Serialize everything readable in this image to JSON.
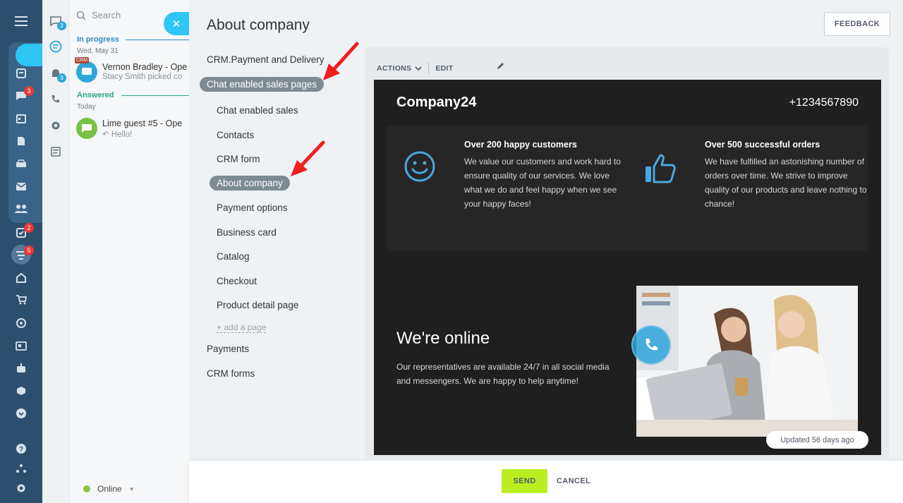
{
  "colors": {
    "accent": "#2fc6f6",
    "send": "#bbed21",
    "sidebar": "#2c4f6e",
    "arrow": "#f01e1e"
  },
  "iconbar": {
    "icons": [
      "menu-icon",
      "feed-icon",
      "chat-icon",
      "calendar-icon",
      "document-icon",
      "drive-icon",
      "mail-icon",
      "group-icon",
      "tasks-icon",
      "crm-icon",
      "sites-icon",
      "shop-icon",
      "marketing-icon",
      "contact-center-icon",
      "robot-icon",
      "apps-icon",
      "more-icon",
      "help-icon",
      "sitemap-icon",
      "settings-icon"
    ],
    "badges": {
      "chat": "3",
      "tasks": "2",
      "crm": "5"
    }
  },
  "chatbar": {
    "badges": {
      "messages": "3",
      "notifications": "3"
    }
  },
  "chatlist": {
    "search_placeholder": "Search",
    "section_progress": "In progress",
    "date1": "Wed, May 31",
    "chat1": {
      "tag": "CRM",
      "name": "Vernon Bradley - Ope",
      "sub": "Stacy Smith picked co"
    },
    "section_answered": "Answered",
    "date2": "Today",
    "chat2": {
      "name": "Lime guest #5 - Ope",
      "sub": "Hello!"
    },
    "status": "Online"
  },
  "slider": {
    "title": "About company",
    "feedback": "FEEDBACK",
    "tree": {
      "crm_payment": "CRM.Payment and Delivery",
      "chat_pages": "Chat enabled sales pages",
      "chat_sales": "Chat enabled sales",
      "contacts": "Contacts",
      "crm_form": "CRM form",
      "about": "About company",
      "payment_options": "Payment options",
      "business_card": "Business card",
      "catalog": "Catalog",
      "checkout": "Checkout",
      "product_detail": "Product detail page",
      "add_page": "+ add a page",
      "payments": "Payments",
      "crm_forms": "CRM forms"
    },
    "toolbar": {
      "actions": "ACTIONS",
      "edit": "EDIT"
    },
    "preview": {
      "brand": "Company24",
      "phone": "+1234567890",
      "feature1": {
        "title": "Over 200 happy customers",
        "text": "We value our customers and work hard to ensure quality of our services. We love what we do and feel happy when we see your happy faces!"
      },
      "feature2": {
        "title": "Over 500 successful orders",
        "text": "We have fulfilled an astonishing number of orders over time. We strive to improve quality of our products and leave nothing to chance!"
      },
      "online_title": "We're online",
      "online_text": "Our representatives are available 24/7 in all social media and messengers. We are happy to help anytime!"
    },
    "updated": "Updated 56 days ago",
    "footer": {
      "send": "SEND",
      "cancel": "CANCEL"
    }
  }
}
